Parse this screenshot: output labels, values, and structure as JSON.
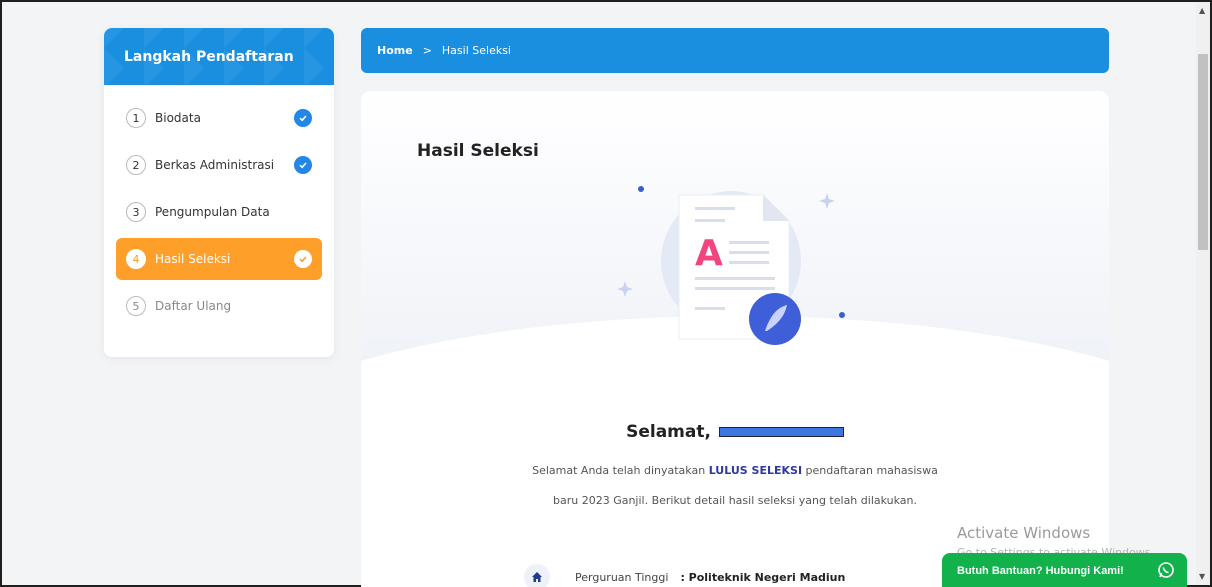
{
  "sidebar": {
    "title": "Langkah Pendaftaran",
    "steps": [
      {
        "num": "1",
        "label": "Biodata"
      },
      {
        "num": "2",
        "label": "Berkas Administrasi"
      },
      {
        "num": "3",
        "label": "Pengumpulan Data"
      },
      {
        "num": "4",
        "label": "Hasil Seleksi"
      },
      {
        "num": "5",
        "label": "Daftar Ulang"
      }
    ]
  },
  "breadcrumb": {
    "home": "Home",
    "separator": ">",
    "current": "Hasil Seleksi"
  },
  "main": {
    "title": "Hasil Seleksi",
    "greeting": "Selamat,",
    "desc_before": "Selamat Anda telah dinyatakan ",
    "desc_highlight": "LULUS SELEKSI",
    "desc_after": " pendaftaran mahasiswa",
    "desc_line2": "baru 2023 Ganjil. Berikut detail hasil seleksi yang telah dilakukan.",
    "detail": {
      "label": "Perguruan Tinggi",
      "value": ": Politeknik Negeri Madiun"
    }
  },
  "watermark": {
    "title": "Activate Windows",
    "sub": "Go to Settings to activate Windows."
  },
  "help_button": {
    "label": "Butuh Bantuan? Hubungi Kami!"
  },
  "colors": {
    "primary": "#1a8fe0",
    "active_step": "#fd9f29",
    "whatsapp": "#12b14c",
    "highlight": "#2f3a9e"
  }
}
